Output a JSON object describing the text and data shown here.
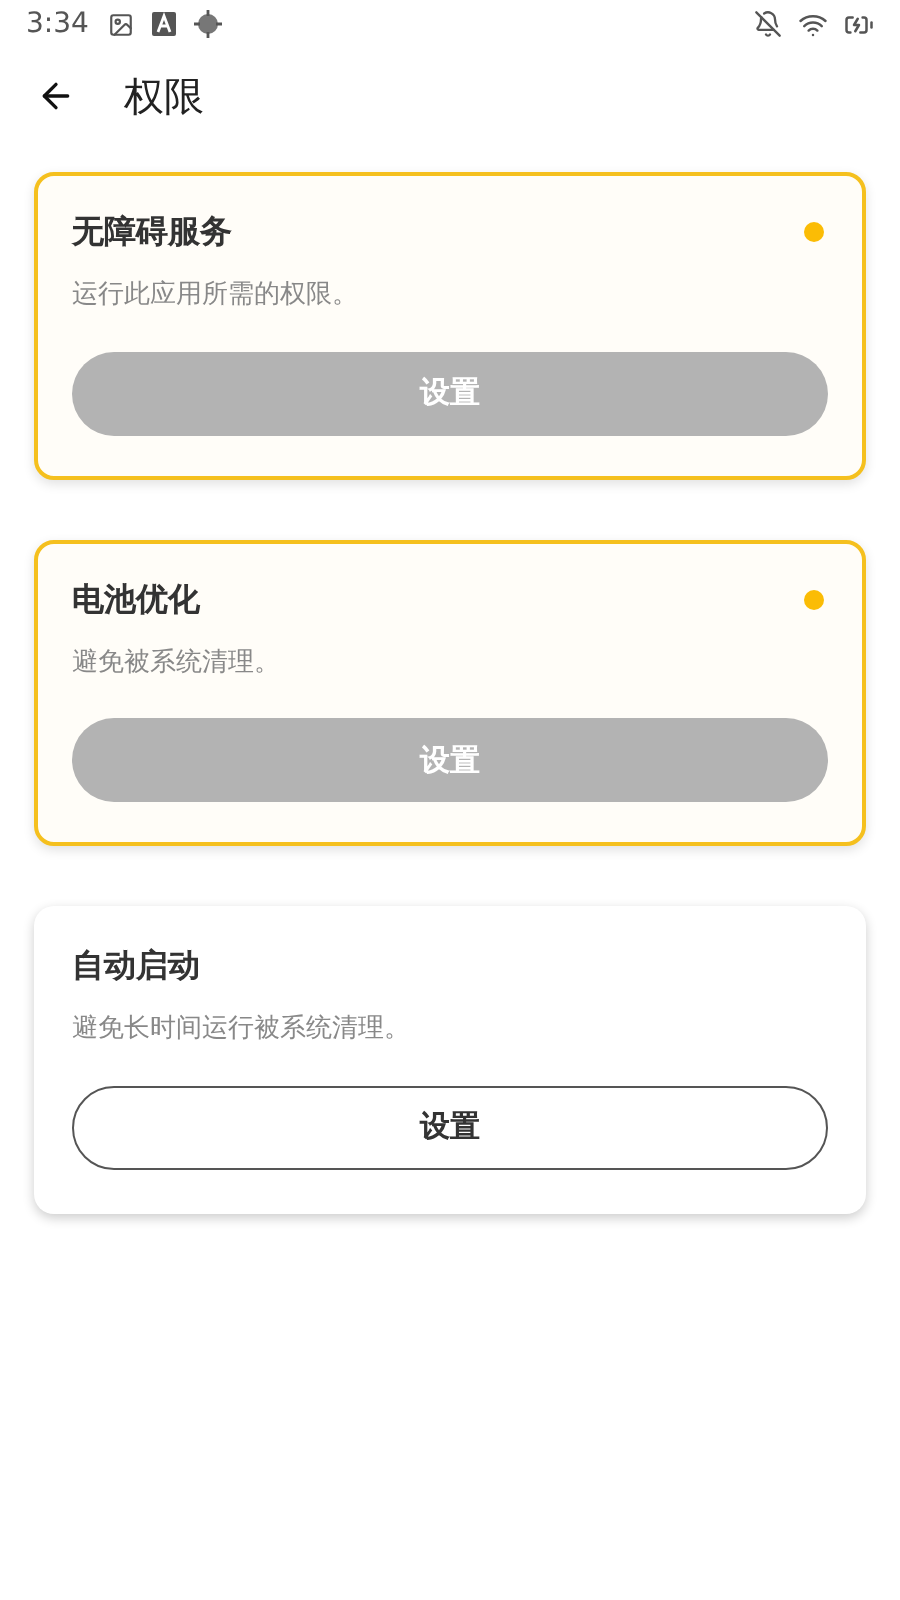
{
  "status_bar": {
    "time": "3:34"
  },
  "app_bar": {
    "title": "权限"
  },
  "permissions": [
    {
      "title": "无障碍服务",
      "description": "运行此应用所需的权限。",
      "button": "设置",
      "granted": false
    },
    {
      "title": "电池优化",
      "description": "避免被系统清理。",
      "button": "设置",
      "granted": false
    },
    {
      "title": "自动启动",
      "description": "避免长时间运行被系统清理。",
      "button": "设置",
      "granted": true
    }
  ]
}
